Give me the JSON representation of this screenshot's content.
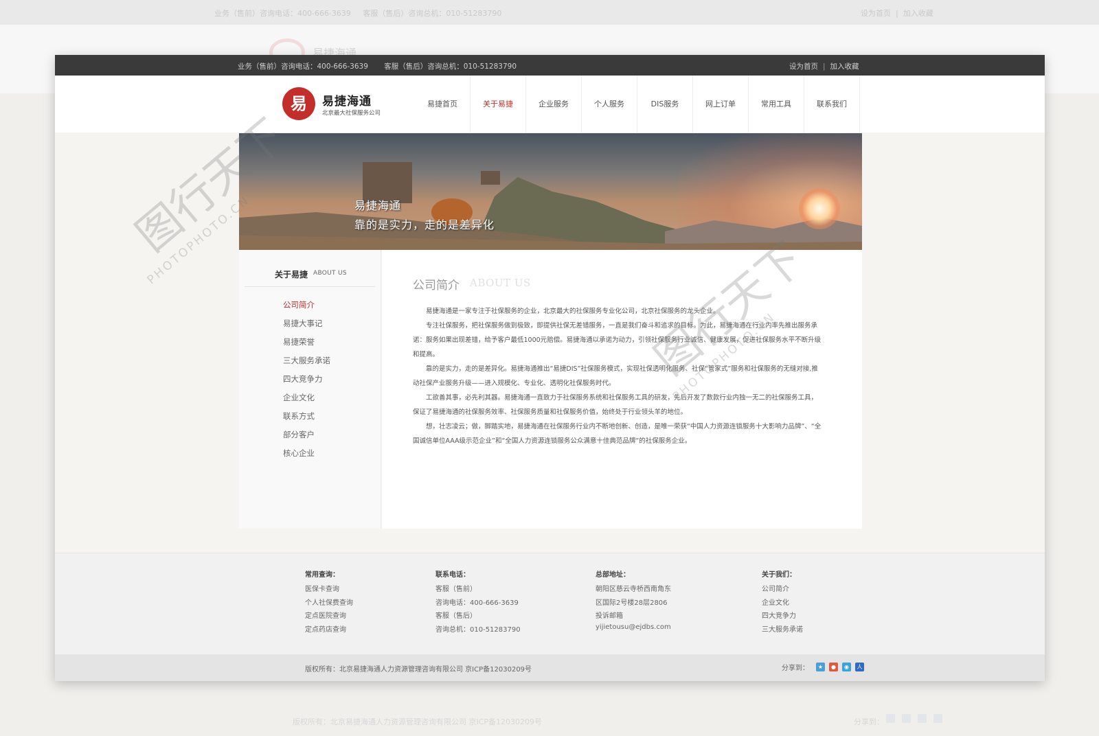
{
  "top_bar": {
    "presale_phone": "业务（售前）咨询电话：400-666-3639",
    "aftersale_phone": "客服（售后）咨询总机：010-51283790",
    "set_home": "设为首页",
    "separator": "|",
    "add_favorite": "加入收藏"
  },
  "brand": {
    "logo_glyph": "易",
    "name": "易捷海通",
    "tagline": "北京最大社保服务公司",
    "accent_color": "#c42e2a"
  },
  "nav": {
    "items": [
      {
        "label": "易捷首页"
      },
      {
        "label": "关于易捷"
      },
      {
        "label": "企业服务"
      },
      {
        "label": "个人服务"
      },
      {
        "label": "DIS服务"
      },
      {
        "label": "网上订单"
      },
      {
        "label": "常用工具"
      },
      {
        "label": "联系我们"
      }
    ],
    "active": "关于易捷"
  },
  "banner": {
    "line1": "易捷海通",
    "line2": "靠的是实力，走的是差异化"
  },
  "sidebar": {
    "title": "关于易捷",
    "title_en": "ABOUT US",
    "items": [
      {
        "label": "公司简介"
      },
      {
        "label": "易捷大事记"
      },
      {
        "label": "易捷荣誉"
      },
      {
        "label": "三大服务承诺"
      },
      {
        "label": "四大竞争力"
      },
      {
        "label": "企业文化"
      },
      {
        "label": "联系方式"
      },
      {
        "label": "部分客户"
      },
      {
        "label": "核心企业"
      }
    ]
  },
  "content": {
    "title": "公司简介",
    "title_en": "ABOUT US",
    "paragraphs": [
      "易捷海通是一家专注于社保服务的企业，北京最大的社保服务专业化公司，北京社保服务的龙头企业。",
      "专注社保服务，把社保服务做到极致，即提供社保无差错服务，一直是我们奋斗和追求的目标。为此，易捷海通在行业内率先推出服务承诺：服务如果出现差错，给予客户最低1000元赔偿。易捷海通以承诺为动力，引领社保服务行业诚信、健康发展，促进社保服务水平不断升级和提高。",
      "靠的是实力，走的是差异化。易捷海通推出“易捷DIS”社保服务模式，实现社保透明化服务、社保“管家式”服务和社保服务的无缝对接,推动社保产业服务升级——进入规模化、专业化、透明化社保服务时代。",
      "工欲善其事，必先利其器。易捷海通一直致力于社保服务系统和社保服务工具的研发，先后开发了数款行业内独一无二的社保服务工具，保证了易捷海通的社保服务效率、社保服务质量和社保服务价值，始终处于行业领头羊的地位。",
      "想，壮志凌云；做，脚踏实地，易捷海通在社保服务行业内不断地创新、创造，是唯一荣获“中国人力资源连锁服务十大影响力品牌”、“全国诚信单位AAA级示范企业”和“全国人力资源连锁服务公众满意十佳典范品牌”的社保服务企业。"
    ]
  },
  "footer": {
    "query": {
      "title": "常用查询：",
      "items": [
        "医保卡查询",
        "个人社保费查询",
        "定点医院查询",
        "定点药店查询"
      ]
    },
    "contact": {
      "title": "联系电话：",
      "items": [
        "客服（售前）",
        "咨询电话：400-666-3639",
        "客服（售后）",
        "咨询总机：010-51283790"
      ]
    },
    "address": {
      "title": "总部地址：",
      "items": [
        "朝阳区慈云寺桥西南角东",
        "区国际2号楼28层2806",
        "投诉邮箱",
        "yijietousu@ejdbs.com"
      ]
    },
    "about": {
      "title": "关于我们：",
      "items": [
        "公司简介",
        "企业文化",
        "四大竞争力",
        "三大服务承诺"
      ]
    },
    "copyright": "版权所有：北京易捷海通人力资源管理咨询有限公司 京ICP备12030209号",
    "share_label": "分享到：",
    "share_icons": [
      {
        "name": "qzone-icon",
        "color": "#4a9fd8"
      },
      {
        "name": "weibo-icon",
        "color": "#e0583f"
      },
      {
        "name": "tencent-weibo-icon",
        "color": "#3aa4d9"
      },
      {
        "name": "renren-icon",
        "color": "#2d6cc0"
      }
    ]
  },
  "watermark": {
    "text": "图行天下",
    "text_en": "PHOTOPHOTO.CN"
  }
}
